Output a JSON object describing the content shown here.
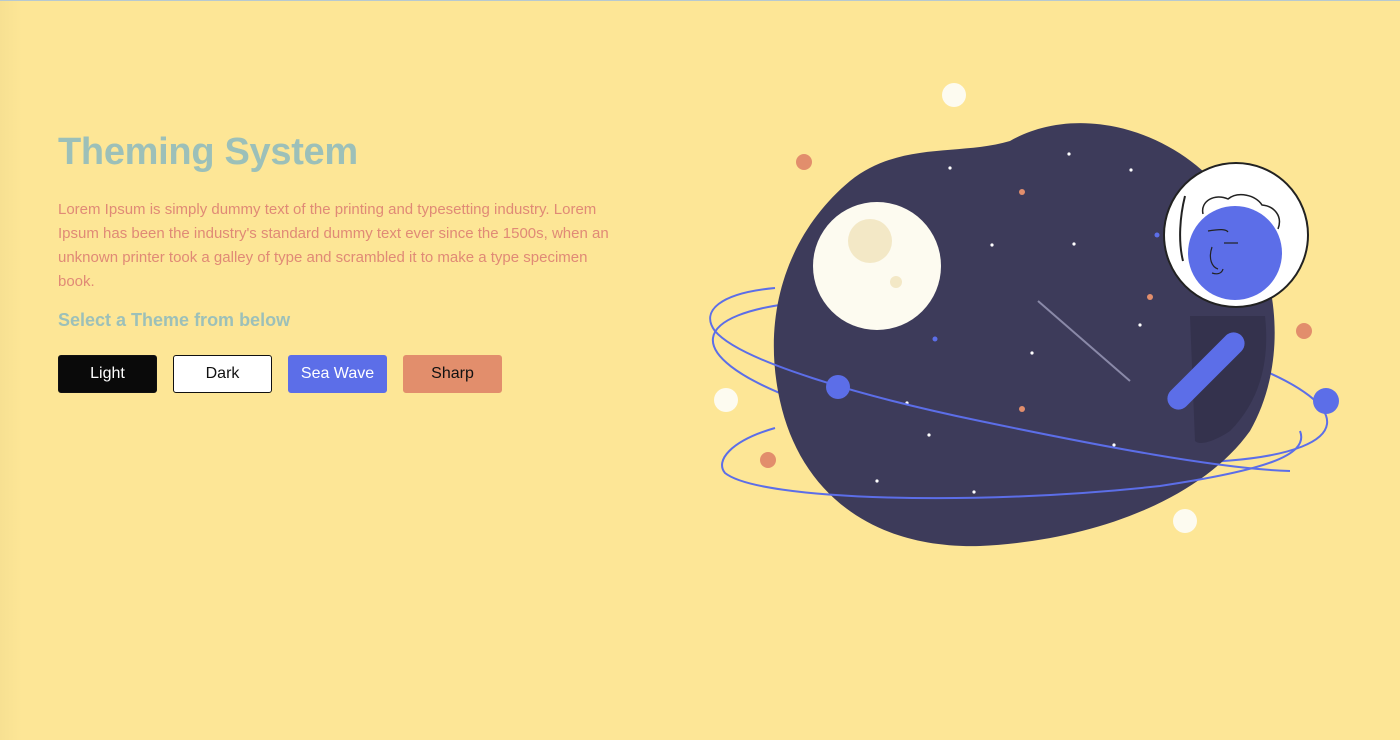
{
  "hero": {
    "title": "Theming System",
    "description": "Lorem Ipsum is simply dummy text of the printing and typesetting industry. Lorem Ipsum has been the industry's standard dummy text ever since the 1500s, when an unknown printer took a galley of type and scrambled it to make a type specimen book.",
    "subtitle": "Select a Theme from below"
  },
  "themes": [
    {
      "label": "Light"
    },
    {
      "label": "Dark"
    },
    {
      "label": "Sea Wave"
    },
    {
      "label": "Sharp"
    }
  ],
  "colors": {
    "background": "#fde696",
    "title": "#9cc0b9",
    "description": "#e08a76",
    "planet": "#3d3b5a",
    "accent_blue": "#5c6ee8",
    "accent_orange": "#e28e6c",
    "moon": "#fdfbf0"
  },
  "illustration": {
    "icon": "astronaut-planet-illustration"
  }
}
